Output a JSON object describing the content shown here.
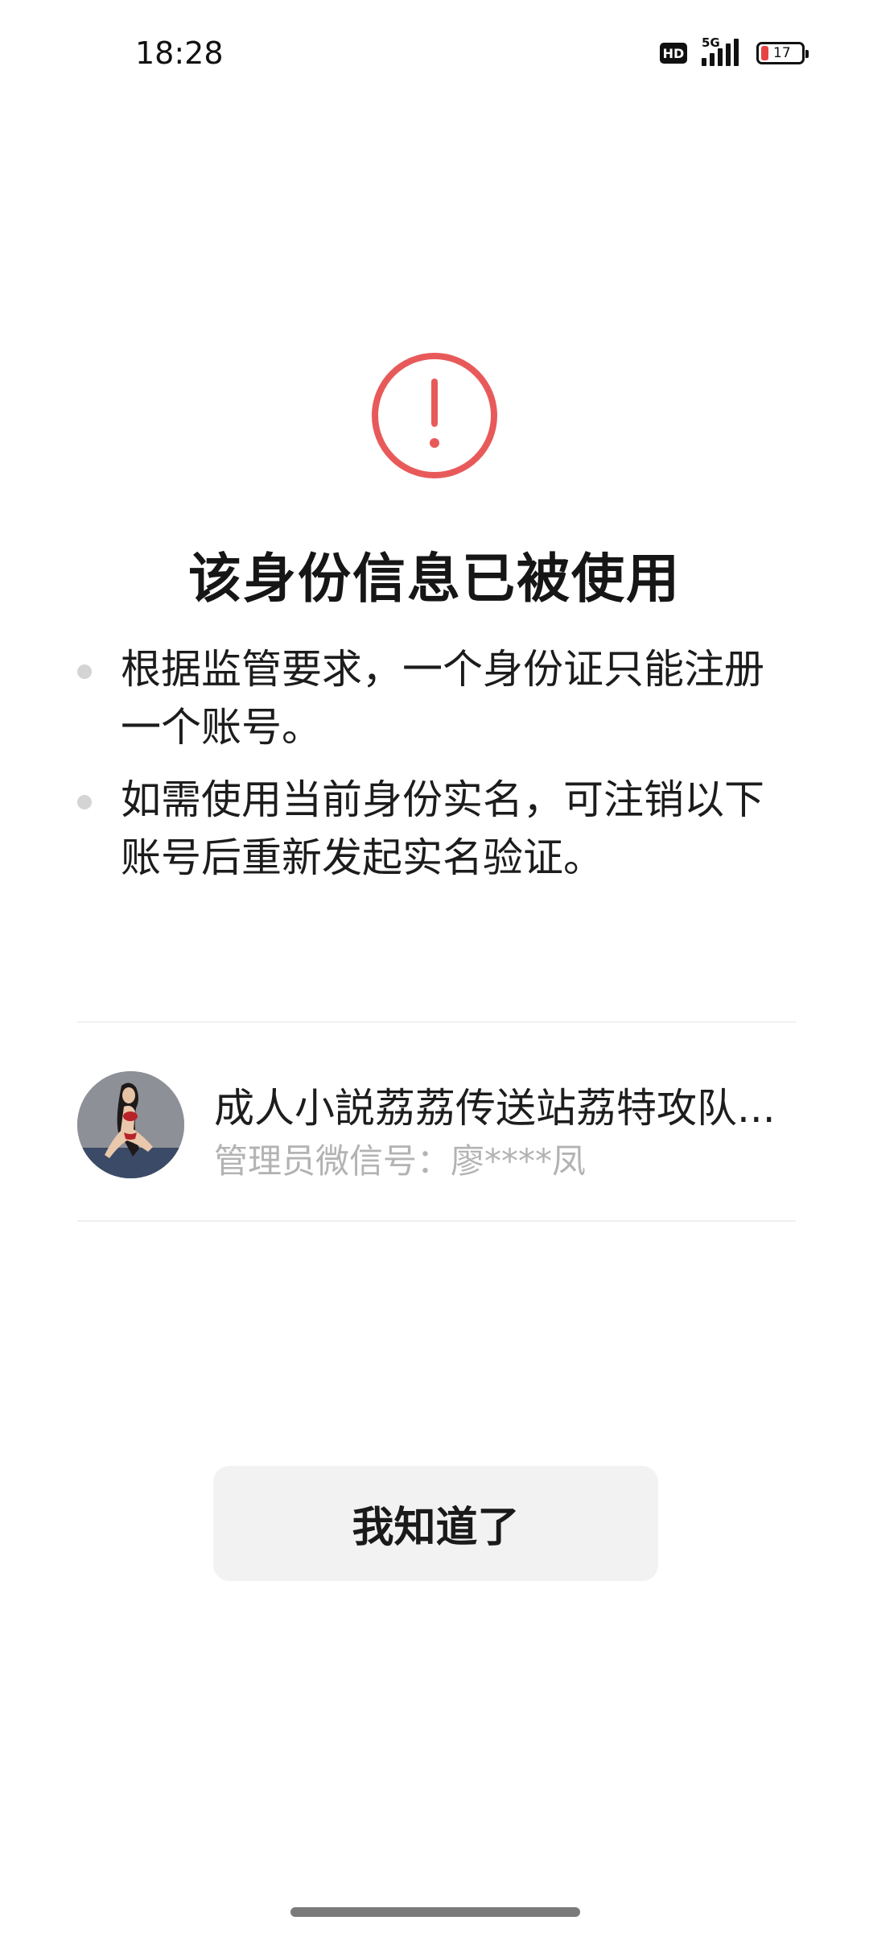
{
  "status_bar": {
    "time": "18:28",
    "hd_label": "HD",
    "network_label": "5G",
    "battery_level": "17",
    "battery_color": "#e64343"
  },
  "alert": {
    "icon": "exclamation-circle-icon",
    "color": "#e85a5a"
  },
  "title": "该身份信息已被使用",
  "bullets": [
    "根据监管要求，一个身份证只能注册一个账号。",
    "如需使用当前身份实名，可注销以下账号后重新发起实名验证。"
  ],
  "account": {
    "name": "成人小説荔荔传送站荔特攻队...",
    "admin_wechat": "管理员微信号：廖****凤"
  },
  "button": {
    "label": "我知道了"
  }
}
